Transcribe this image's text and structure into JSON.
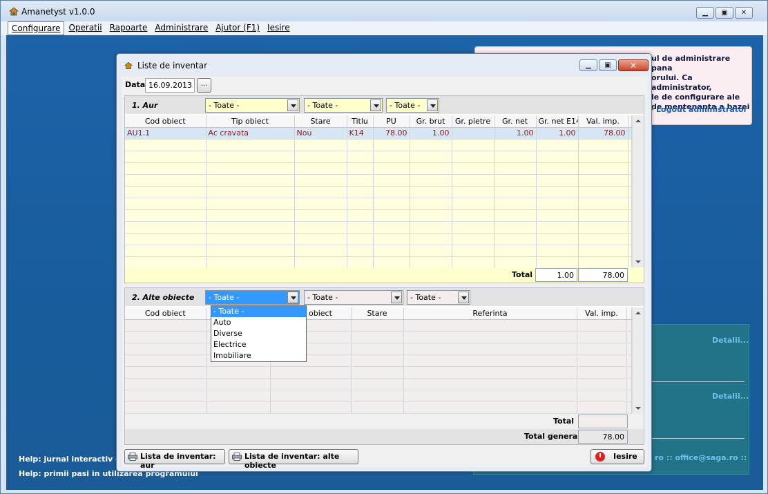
{
  "app": {
    "title": "Amanetyst v1.0.0",
    "menu": [
      "Configurare",
      "Operatii",
      "Rapoarte",
      "Administrare",
      "Ajutor (F1)",
      "Iesire"
    ]
  },
  "admin_box": {
    "lines": [
      "ul de administrare pana",
      "orului. Ca administrator,",
      "le de configurare ale",
      "de mentenanta a bazei"
    ],
    "logout": "Logout administrator"
  },
  "teal_box": {
    "details": [
      "Detalii...",
      "Detalii..."
    ],
    "contact": "ro  ::  office@saga.ro  ::"
  },
  "help": {
    "line1": "Help: jurnal interactiv de c",
    "line2": "Help: primii pasi in utilizarea programului"
  },
  "dialog": {
    "title": "Liste de inventar",
    "data_label": "Data",
    "date_value": "16.09.2013",
    "date_button": "...",
    "section1": {
      "title": "1. Aur",
      "filters": [
        "- Toate -",
        "- Toate -",
        "- Toate -"
      ],
      "columns": [
        "Cod obiect",
        "Tip obiect",
        "Stare",
        "Titlu",
        "PU",
        "Gr. brut",
        "Gr. pietre",
        "Gr. net",
        "Gr. net E14",
        "Val. imp."
      ],
      "rows": [
        [
          "AU1.1",
          "Ac cravata",
          "Nou",
          "K14",
          "78.00",
          "1.00",
          "",
          "1.00",
          "1.00",
          "78.00"
        ]
      ],
      "total_label": "Total",
      "total_gr_net_e14": "1.00",
      "total_val": "78.00"
    },
    "section2": {
      "title": "2. Alte obiecte",
      "filters": [
        "- Toate -",
        "- Toate -",
        "- Toate -"
      ],
      "columns": [
        "Cod obiect",
        "p obiect",
        "Stare",
        "Referinta",
        "Val. imp."
      ],
      "total_label": "Total",
      "total_val": "",
      "total_general_label": "Total general",
      "total_general_val": "78.00"
    },
    "dropdown_options": [
      "- Toate -",
      "Auto",
      "Diverse",
      "Electrice",
      "Imobiliare"
    ],
    "buttons": {
      "print_aur": "Lista de inventar: aur",
      "print_alte": "Lista de inventar: alte obiecte",
      "exit": "Iesire"
    }
  }
}
